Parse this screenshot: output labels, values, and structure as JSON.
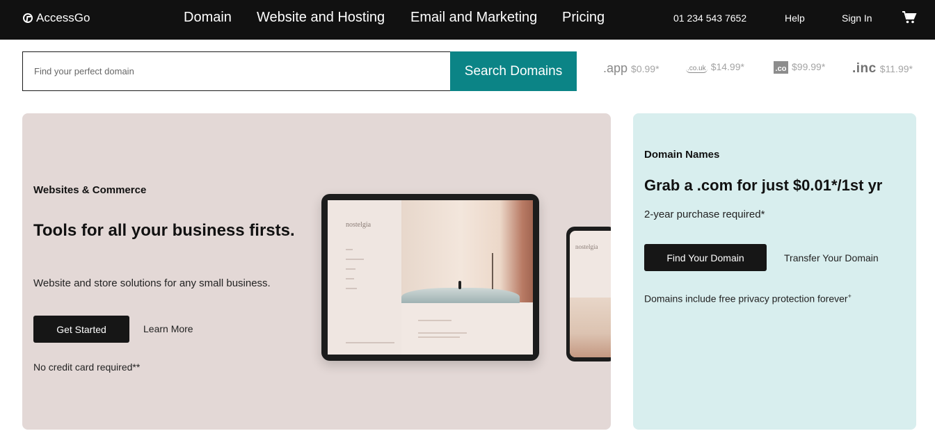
{
  "header": {
    "logo_text": "AccessGo",
    "nav": [
      "Domain",
      "Website and Hosting",
      "Email and Marketing",
      "Pricing"
    ],
    "phone": "01 234 543 7652",
    "help": "Help",
    "sign_in": "Sign In",
    "cart_icon": "cart-icon"
  },
  "search": {
    "placeholder": "Find your perfect domain",
    "button_label": "Search Domains",
    "button_color": "#0b8486"
  },
  "tlds": [
    {
      "name": ".app",
      "price": "$0.99*"
    },
    {
      "name": ".co.uk",
      "price": "$14.99*"
    },
    {
      "name": ".co",
      "price": "$99.99*"
    },
    {
      "name": ".inc",
      "price": "$11.99*"
    }
  ],
  "websites_panel": {
    "eyebrow": "Websites & Commerce",
    "headline": "Tools for all your business firsts.",
    "subtext": "Website and store solutions for any small business.",
    "primary_button": "Get Started",
    "secondary_link": "Learn More",
    "note": "No credit card required**",
    "background": "#e3d8d6",
    "mockup_logo": "nostelgia"
  },
  "domains_panel": {
    "eyebrow": "Domain Names",
    "headline": "Grab a .com for just $0.01*/1st yr",
    "requirement": "2-year purchase required*",
    "primary_button": "Find Your Domain",
    "secondary_link": "Transfer Your Domain",
    "privacy_text": "Domains include free privacy protection forever",
    "privacy_mark": "+",
    "background": "#d8eeee"
  }
}
